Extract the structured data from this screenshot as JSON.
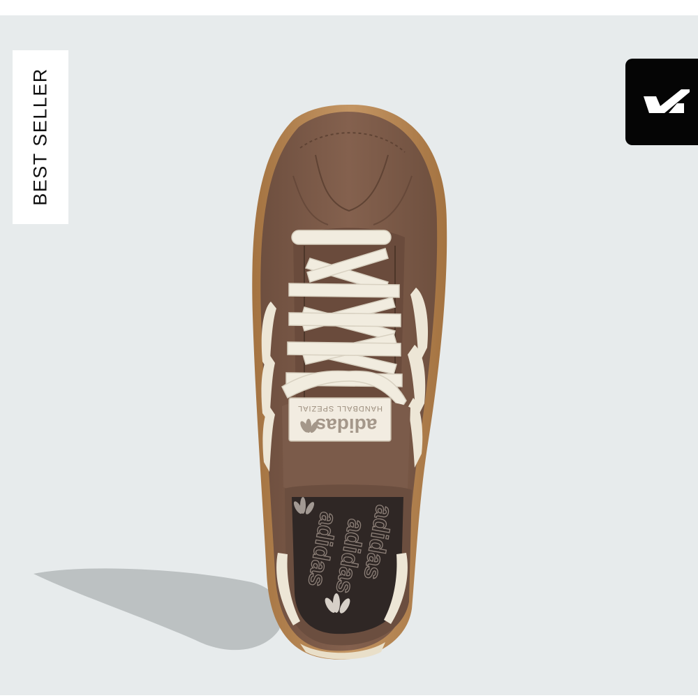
{
  "badge": {
    "label": "BEST SELLER"
  },
  "brand_button": {
    "icon": "checkmark-logo-icon"
  },
  "product": {
    "tongue_label_logo": "adidas",
    "tongue_label_model": "HANDBALL SPEZIAL",
    "insole_text": "adidas",
    "colors": {
      "upper": "#7a5a49",
      "stripes": "#ede6d6",
      "laces": "#f1ecdf",
      "sole": "#b98a52",
      "background": "#e7ebec"
    }
  }
}
